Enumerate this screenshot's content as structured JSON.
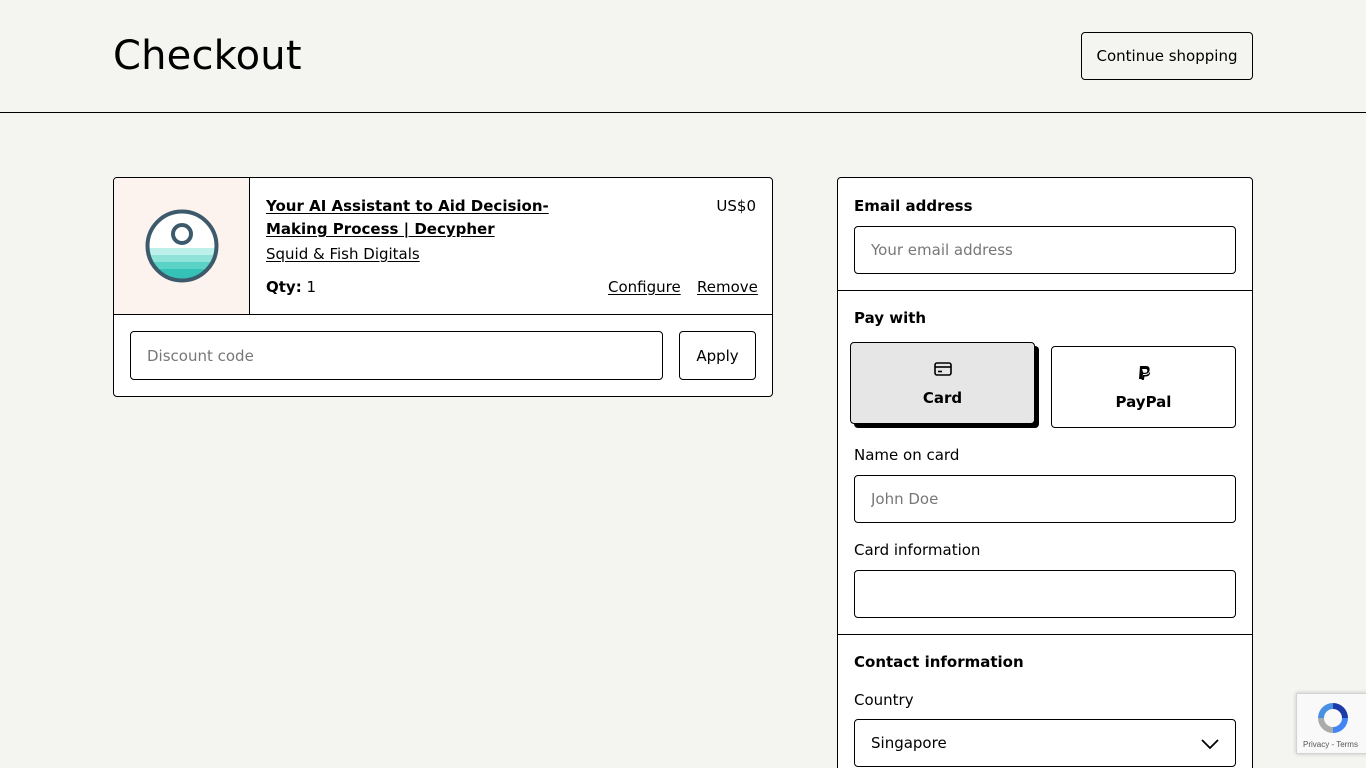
{
  "header": {
    "title": "Checkout",
    "continue_label": "Continue shopping"
  },
  "cart": {
    "item": {
      "title": "Your AI Assistant to Aid Decision-Making Process | Decypher",
      "seller": "Squid & Fish Digitals",
      "price": "US$0",
      "qty_label": "Qty:",
      "qty_value": "1",
      "configure_label": "Configure",
      "remove_label": "Remove",
      "thumbnail_icon": "decypher-logo-icon"
    },
    "discount": {
      "placeholder": "Discount code",
      "apply_label": "Apply"
    }
  },
  "payment": {
    "email_label": "Email address",
    "email_placeholder": "Your email address",
    "pay_with_label": "Pay with",
    "methods": [
      {
        "label": "Card",
        "icon": "credit-card-icon",
        "selected": true
      },
      {
        "label": "PayPal",
        "icon": "paypal-icon",
        "selected": false
      }
    ],
    "name_label": "Name on card",
    "name_placeholder": "John Doe",
    "card_info_label": "Card information",
    "contact_label": "Contact information",
    "country_label": "Country",
    "country_value": "Singapore"
  },
  "recaptcha": {
    "footer": "Privacy - Terms"
  },
  "colors": {
    "page_bg": "#f4f4f0",
    "thumb_bg": "#fdf3ee",
    "selected_method_bg": "#e6e6e6",
    "logo_ring": "#3d5a6c",
    "logo_water": "#4fd1c5"
  }
}
